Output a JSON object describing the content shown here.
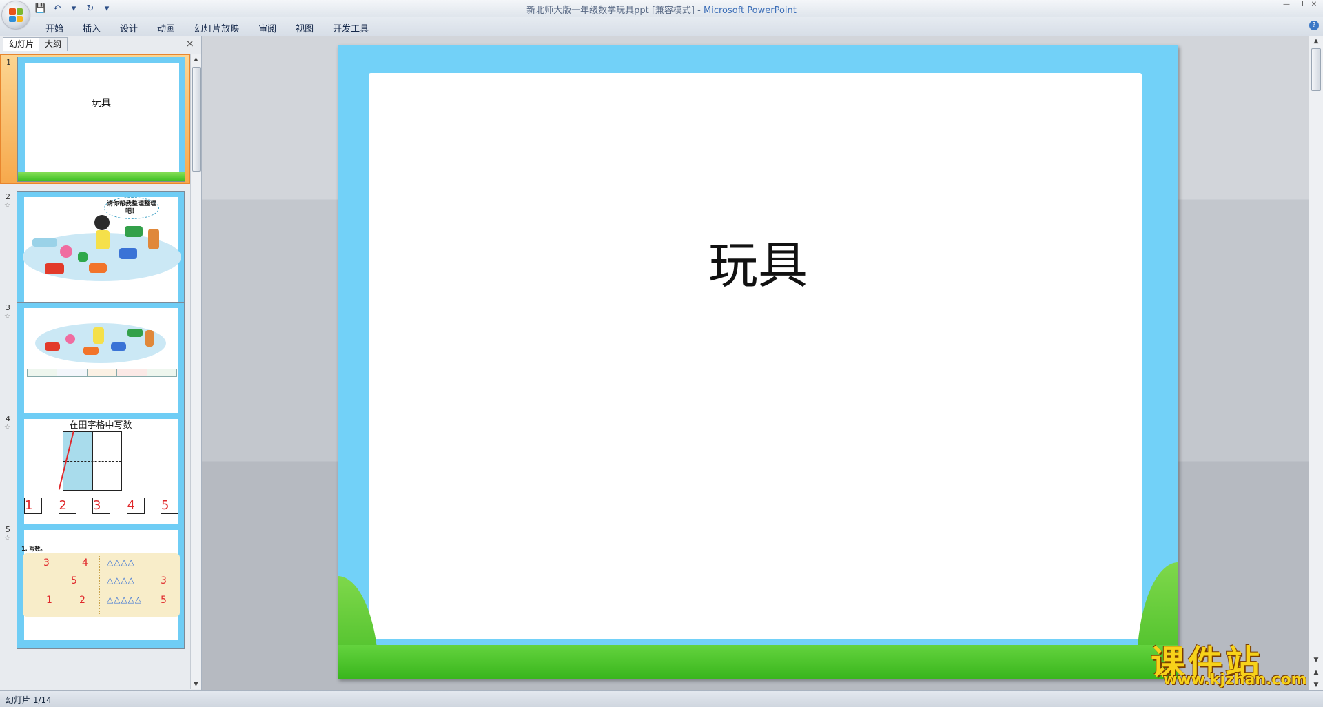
{
  "window": {
    "title_doc": "新北师大版一年级数学玩具ppt [兼容模式]",
    "title_sep": " - ",
    "title_app": "Microsoft PowerPoint"
  },
  "ribbon": {
    "tabs": [
      "开始",
      "插入",
      "设计",
      "动画",
      "幻灯片放映",
      "审阅",
      "视图",
      "开发工具"
    ]
  },
  "panel": {
    "tab_slides": "幻灯片",
    "tab_outline": "大纲",
    "close_glyph": "×"
  },
  "thumbnails": [
    {
      "num": "1",
      "title": "玩具"
    },
    {
      "num": "2",
      "bubble": "请你帮我整理整理吧！"
    },
    {
      "num": "3"
    },
    {
      "num": "4",
      "title": "在田字格中写数",
      "digits": [
        "1",
        "2",
        "3",
        "4",
        "5"
      ]
    },
    {
      "num": "5",
      "heading": "1. 写数。",
      "left_digits": [
        "3",
        "4",
        "5",
        "1",
        "2"
      ],
      "right_digits": [
        "3",
        "5"
      ]
    }
  ],
  "slide": {
    "title": "玩具"
  },
  "watermark": {
    "cn": "课件站",
    "url": "www.kjzhan.com"
  },
  "status": {
    "text": "幻灯片 1/14"
  },
  "colors": {
    "slide_border": "#72d1f8",
    "grass": "#45bc25",
    "selected_thumb": "#f7a94c"
  }
}
